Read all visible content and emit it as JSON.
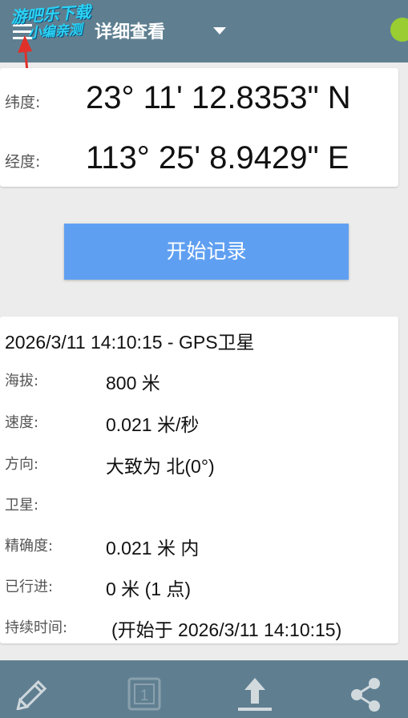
{
  "header": {
    "title": "详细查看",
    "watermark_line1": "游吧乐下载",
    "watermark_line2": "小编亲测"
  },
  "coordinates": {
    "latitude_label": "纬度:",
    "latitude_value": "23° 11' 12.8353\" N",
    "longitude_label": "经度:",
    "longitude_value": "113° 25' 8.9429\" E"
  },
  "record_button_label": "开始记录",
  "details": {
    "header": "2026/3/11 14:10:15 - GPS卫星",
    "rows": [
      {
        "label": "海拔:",
        "value": "800 米"
      },
      {
        "label": "速度:",
        "value": "0.021 米/秒"
      },
      {
        "label": "方向:",
        "value": "大致为 北(0°)"
      },
      {
        "label": "卫星:",
        "value": ""
      },
      {
        "label": "精确度:",
        "value": "0.021 米 内"
      },
      {
        "label": "已行进:",
        "value": "0 米 (1 点)"
      },
      {
        "label": "持续时间:",
        "value": "(开始于 2026/3/11 14:10:15)"
      }
    ]
  },
  "bottom_bar": {
    "items": [
      {
        "icon": "pencil-icon"
      },
      {
        "icon": "counter-icon",
        "value": "1"
      },
      {
        "icon": "upload-icon"
      },
      {
        "icon": "share-icon"
      }
    ]
  },
  "colors": {
    "bar": "#5f7f91",
    "accent_button": "#5f9ff1",
    "status_dot": "#9acd32",
    "watermark": "#2ad3f5",
    "arrow": "#e0302a"
  }
}
